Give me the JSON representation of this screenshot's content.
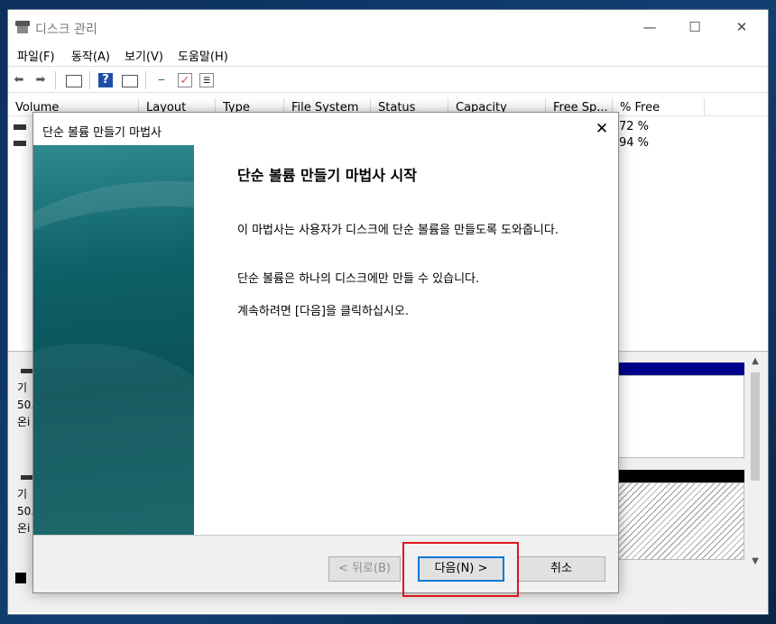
{
  "app": {
    "title": "디스크 관리",
    "controls": {
      "minimize": "—",
      "maximize": "☐",
      "close": "✕"
    }
  },
  "menu": [
    "파일(F)",
    "동작(A)",
    "보기(V)",
    "도움말(H)"
  ],
  "toolbar_icons": [
    "back-arrow-icon",
    "forward-arrow-icon",
    "console-tree-icon",
    "help-icon",
    "properties-icon",
    "connect-icon",
    "check-icon",
    "list-icon"
  ],
  "columns": [
    "Volume",
    "Layout",
    "Type",
    "File System",
    "Status",
    "Capacity",
    "Free Sp...",
    "% Free"
  ],
  "volumes": [
    {
      "free_pct": "72 %"
    },
    {
      "free_pct": "94 %"
    }
  ],
  "disks": [
    {
      "line1": "기",
      "line2": "50.",
      "line3": "온i"
    },
    {
      "line1": "기",
      "line2": "50.",
      "line3": "온i"
    }
  ],
  "wizard": {
    "title": "단순 볼륨 만들기 마법사",
    "heading": "단순 볼륨 만들기 마법사 시작",
    "para1": "이 마법사는 사용자가 디스크에 단순 볼륨을 만들도록 도와줍니다.",
    "para2": "단순 볼륨은 하나의 디스크에만 만들 수 있습니다.",
    "para3": "계속하려면 [다음]을 클릭하십시오.",
    "back_label": "< 뒤로(B)",
    "next_label": "다음(N) >",
    "cancel_label": "취소",
    "close": "✕"
  },
  "colors": {
    "highlight": "#e0161b",
    "accent": "#0078d7",
    "sidebar": "#0a5259"
  }
}
